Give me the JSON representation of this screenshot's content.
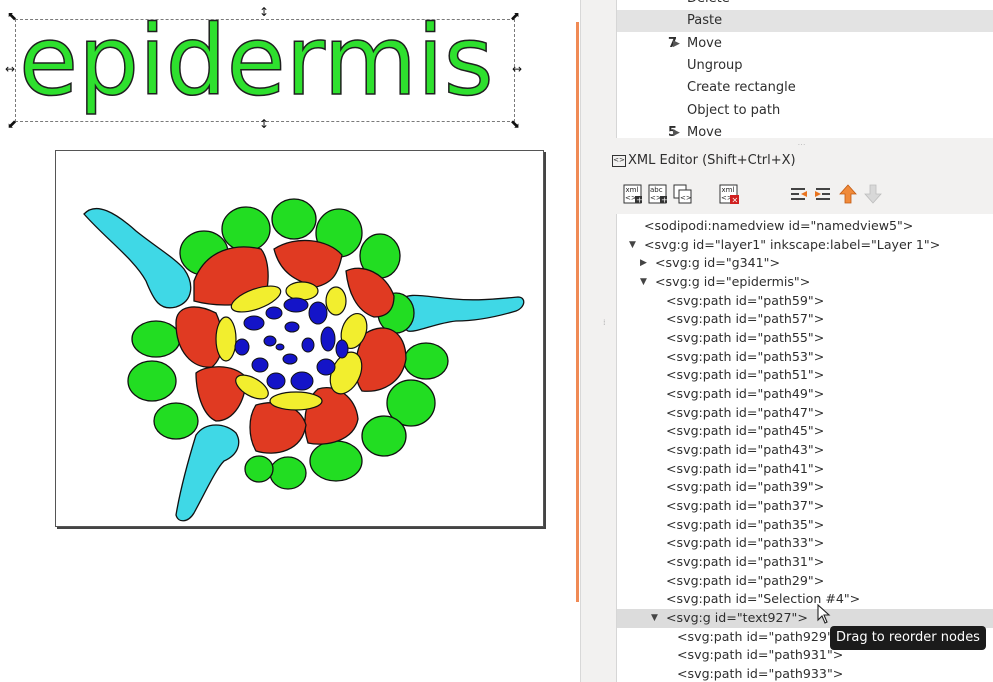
{
  "canvas": {
    "text_object": "epidermis",
    "colors": {
      "text_fill": "#2ee02e",
      "epidermis": "#22dd22",
      "cortex": "#e03a22",
      "endodermis": "#f2ee2e",
      "vascular": "#1414c8",
      "root_hair": "#3fd8e6"
    }
  },
  "history": {
    "items": [
      {
        "num": "",
        "label": "Delete",
        "arrow": false,
        "selected": false
      },
      {
        "num": "",
        "label": "Paste",
        "arrow": false,
        "selected": true
      },
      {
        "num": "7",
        "label": "Move",
        "arrow": true,
        "selected": false
      },
      {
        "num": "",
        "label": "Ungroup",
        "arrow": false,
        "selected": false
      },
      {
        "num": "",
        "label": "Create rectangle",
        "arrow": false,
        "selected": false
      },
      {
        "num": "",
        "label": "Object to path",
        "arrow": false,
        "selected": false
      },
      {
        "num": "5",
        "label": "Move",
        "arrow": true,
        "selected": false
      }
    ]
  },
  "xml_editor": {
    "title": "XML Editor (Shift+Ctrl+X)",
    "toolbar_icons": [
      "new-element-node-icon",
      "new-text-node-icon",
      "duplicate-node-icon",
      "delete-node-icon",
      "unindent-node-icon",
      "indent-node-icon",
      "raise-node-icon",
      "lower-node-icon"
    ],
    "nodes": [
      {
        "text": "<sodipodi:namedview id=\"namedview5\">",
        "indent": 0,
        "tri": "",
        "selected": false
      },
      {
        "text": "<svg:g id=\"layer1\" inkscape:label=\"Layer 1\">",
        "indent": 0,
        "tri": "down",
        "selected": false
      },
      {
        "text": "<svg:g id=\"g341\">",
        "indent": 1,
        "tri": "right",
        "selected": false
      },
      {
        "text": "<svg:g id=\"epidermis\">",
        "indent": 1,
        "tri": "down",
        "selected": false
      },
      {
        "text": "<svg:path id=\"path59\">",
        "indent": 2,
        "tri": "",
        "selected": false
      },
      {
        "text": "<svg:path id=\"path57\">",
        "indent": 2,
        "tri": "",
        "selected": false
      },
      {
        "text": "<svg:path id=\"path55\">",
        "indent": 2,
        "tri": "",
        "selected": false
      },
      {
        "text": "<svg:path id=\"path53\">",
        "indent": 2,
        "tri": "",
        "selected": false
      },
      {
        "text": "<svg:path id=\"path51\">",
        "indent": 2,
        "tri": "",
        "selected": false
      },
      {
        "text": "<svg:path id=\"path49\">",
        "indent": 2,
        "tri": "",
        "selected": false
      },
      {
        "text": "<svg:path id=\"path47\">",
        "indent": 2,
        "tri": "",
        "selected": false
      },
      {
        "text": "<svg:path id=\"path45\">",
        "indent": 2,
        "tri": "",
        "selected": false
      },
      {
        "text": "<svg:path id=\"path43\">",
        "indent": 2,
        "tri": "",
        "selected": false
      },
      {
        "text": "<svg:path id=\"path41\">",
        "indent": 2,
        "tri": "",
        "selected": false
      },
      {
        "text": "<svg:path id=\"path39\">",
        "indent": 2,
        "tri": "",
        "selected": false
      },
      {
        "text": "<svg:path id=\"path37\">",
        "indent": 2,
        "tri": "",
        "selected": false
      },
      {
        "text": "<svg:path id=\"path35\">",
        "indent": 2,
        "tri": "",
        "selected": false
      },
      {
        "text": "<svg:path id=\"path33\">",
        "indent": 2,
        "tri": "",
        "selected": false
      },
      {
        "text": "<svg:path id=\"path31\">",
        "indent": 2,
        "tri": "",
        "selected": false
      },
      {
        "text": "<svg:path id=\"path29\">",
        "indent": 2,
        "tri": "",
        "selected": false
      },
      {
        "text": "<svg:path id=\"Selection #4\">",
        "indent": 2,
        "tri": "",
        "selected": false
      },
      {
        "text": "<svg:g id=\"text927\">",
        "indent": 1.5,
        "tri": "down",
        "selected": true
      },
      {
        "text": "<svg:path id=\"path929\">",
        "indent": 2.5,
        "tri": "",
        "selected": false
      },
      {
        "text": "<svg:path id=\"path931\">",
        "indent": 2.5,
        "tri": "",
        "selected": false
      },
      {
        "text": "<svg:path id=\"path933\">",
        "indent": 2.5,
        "tri": "",
        "selected": false
      }
    ]
  },
  "tooltip": "Drag to reorder nodes"
}
